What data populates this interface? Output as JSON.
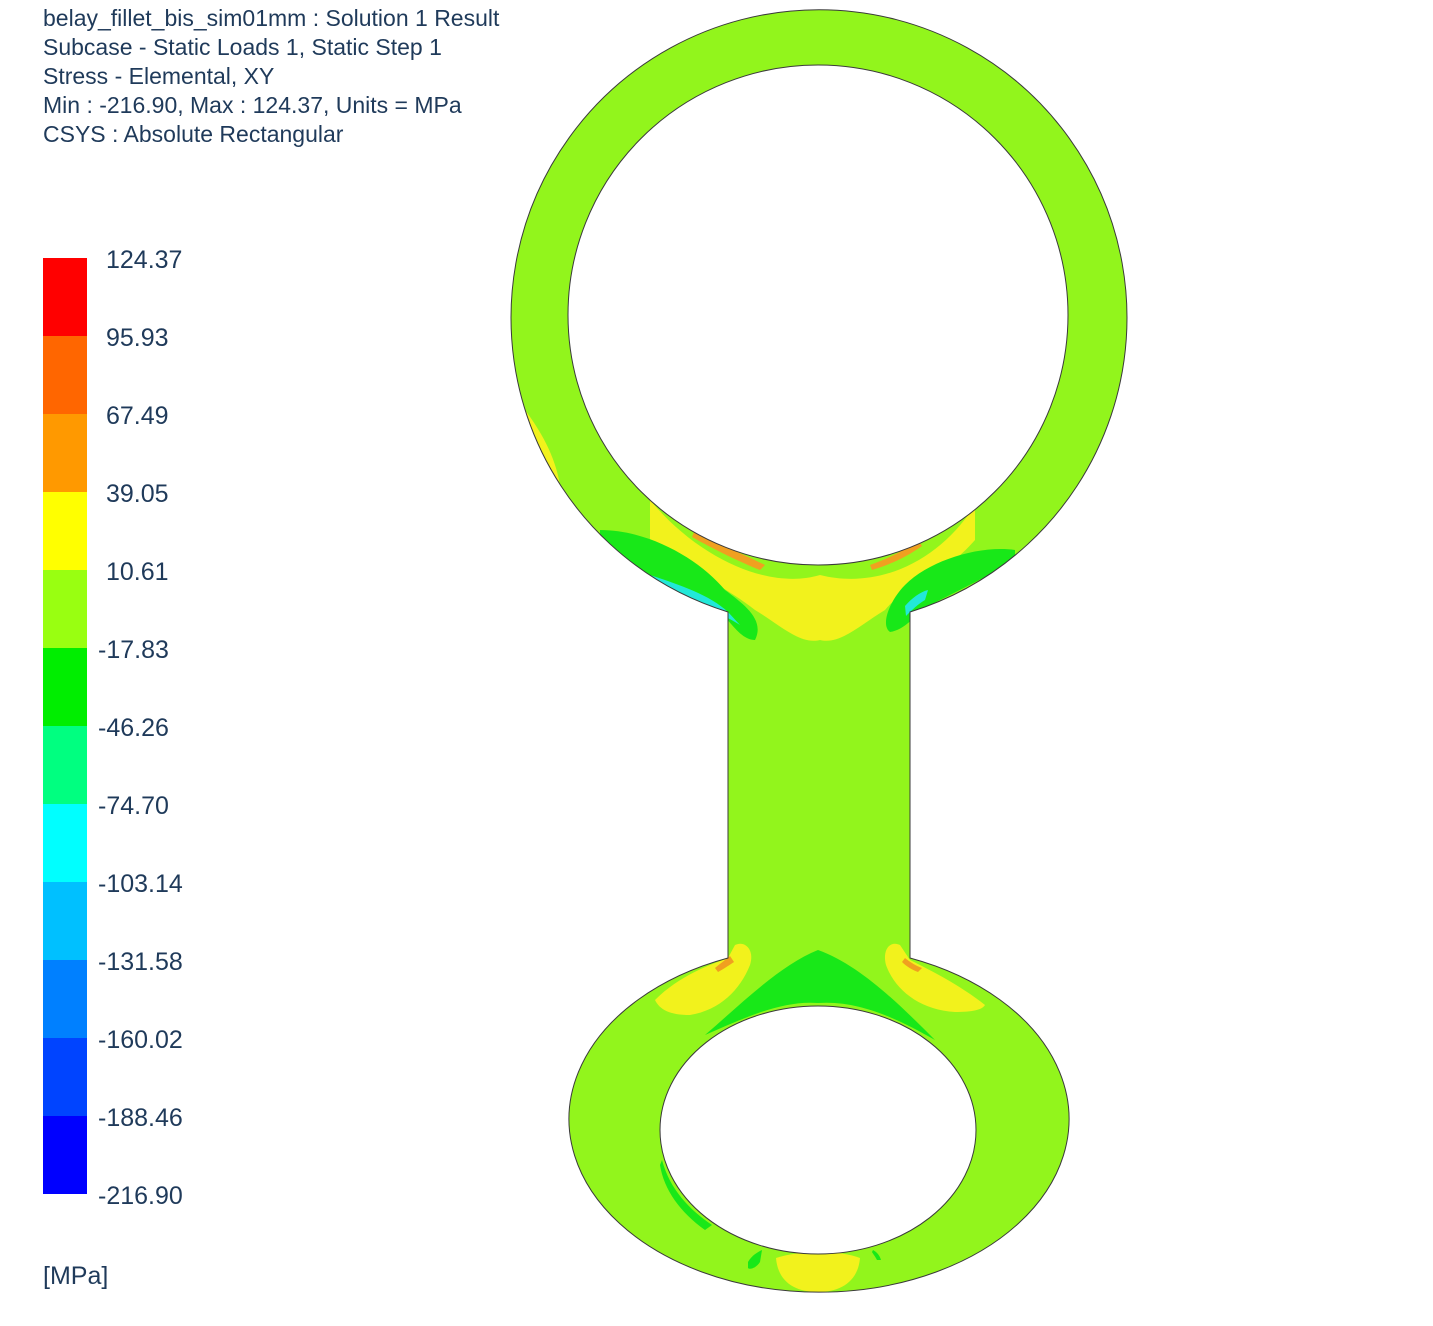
{
  "header": {
    "lines": [
      "belay_fillet_bis_sim01mm : Solution 1 Result",
      "Subcase - Static Loads 1, Static Step 1",
      "Stress - Elemental, XY",
      "Min : -216.90, Max : 124.37, Units = MPa",
      "CSYS : Absolute Rectangular"
    ]
  },
  "legend": {
    "labels": [
      "124.37",
      "95.93",
      "67.49",
      "39.05",
      "10.61",
      "-17.83",
      "-46.26",
      "-74.70",
      "-103.14",
      "-131.58",
      "-160.02",
      "-188.46",
      "-216.90"
    ],
    "colors": [
      "#ff0000",
      "#ff6600",
      "#ff9900",
      "#ffff00",
      "#99ff11",
      "#00ee00",
      "#00ff80",
      "#00ffff",
      "#00c0ff",
      "#0080ff",
      "#0044ff",
      "#0000ff"
    ],
    "units": "[MPa]"
  },
  "model": {
    "base_color": "#92f51c",
    "yellow": "#f2f21c",
    "orange": "#f0a020",
    "green": "#18e818",
    "cyan": "#22e8d8",
    "edge_color": "#3a3a3a"
  }
}
